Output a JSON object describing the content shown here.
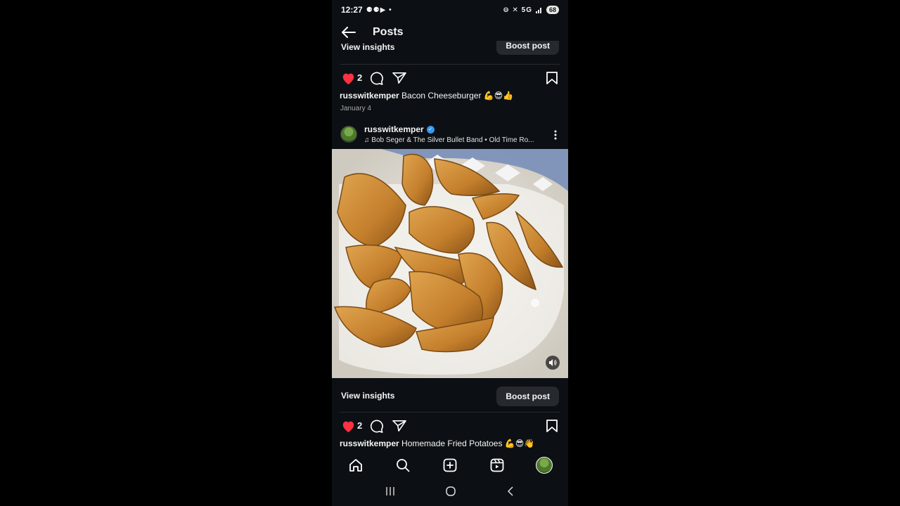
{
  "status": {
    "time": "12:27",
    "left_icons": "⚈⚈▶ •",
    "right_icons": "⊖ ✕ 5G",
    "battery": "68"
  },
  "appbar": {
    "title": "Posts"
  },
  "cut_row": {
    "insights": "View insights",
    "boost": "Boost post"
  },
  "post1": {
    "likes": "2",
    "username": "russwitkemper",
    "caption": "Bacon Cheeseburger 💪😎👍",
    "date": "January 4"
  },
  "post2": {
    "username": "russwitkemper",
    "music": "Bob Seger & The Silver Bullet Band • Old Time Ro...",
    "insights": "View insights",
    "boost": "Boost post",
    "likes": "2",
    "caption_user": "russwitkemper",
    "caption": "Homemade Fried Potatoes 💪😎👋"
  },
  "colors": {
    "background": "#0c1014",
    "like": "#ff3040",
    "verified": "#3897f0",
    "button": "#262a2f"
  },
  "icons": [
    "back-arrow-icon",
    "heart-icon",
    "comment-icon",
    "share-icon",
    "bookmark-icon",
    "more-icon",
    "music-icon",
    "mute-icon",
    "home-icon",
    "search-icon",
    "create-icon",
    "reels-icon",
    "profile-icon"
  ]
}
